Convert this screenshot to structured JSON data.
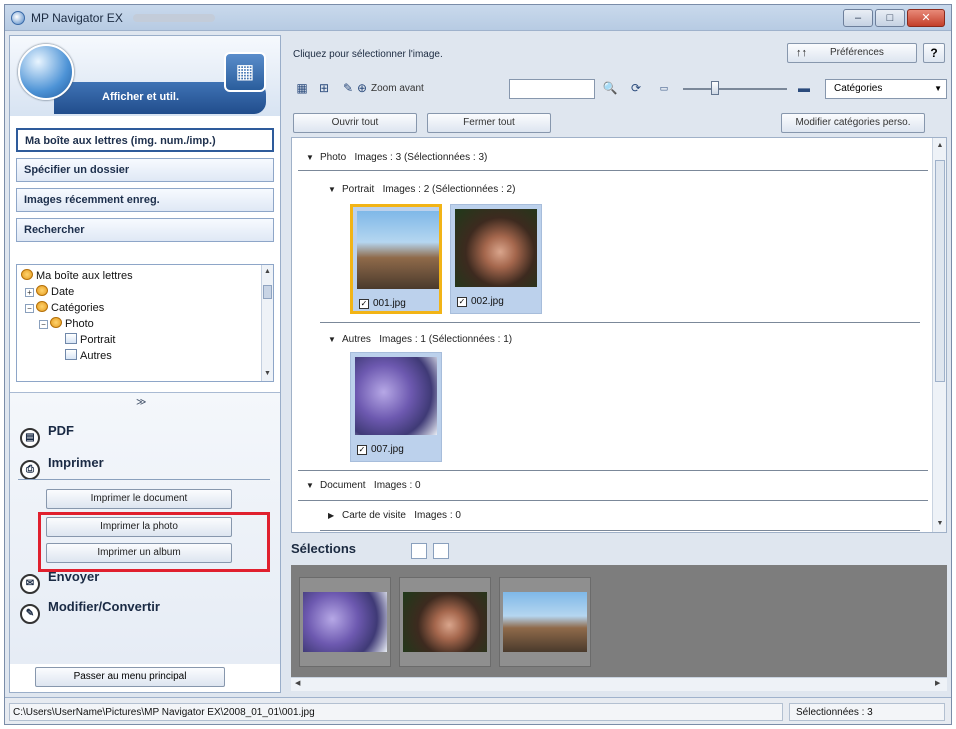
{
  "window": {
    "title": "MP Navigator EX",
    "buttons": {
      "minimize": "–",
      "maximize": "□",
      "close": "✕"
    }
  },
  "left": {
    "header_label": "Afficher et util.",
    "nav": [
      "Ma boîte aux lettres (img. num./imp.)",
      "Spécifier un dossier",
      "Images récemment enreg.",
      "Rechercher"
    ],
    "tree": [
      "Ma boîte aux lettres",
      "Date",
      "Catégories",
      "Photo",
      "Portrait",
      "Autres"
    ],
    "collapse_glyph": "≫",
    "actions": {
      "pdf": "PDF",
      "print": "Imprimer",
      "send": "Envoyer",
      "edit": "Modifier/Convertir"
    },
    "print_buttons": [
      "Imprimer le document",
      "Imprimer la photo",
      "Imprimer un album"
    ],
    "main_menu": "Passer au menu principal"
  },
  "toolbar": {
    "prompt": "Cliquez pour sélectionner l'image.",
    "preferences": "Préférences",
    "help": "?",
    "zoom_label": "Zoom avant",
    "category_select": "Catégories",
    "open_all": "Ouvrir tout",
    "close_all": "Fermer tout",
    "edit_categories": "Modifier catégories perso."
  },
  "groups": {
    "photo": {
      "name": "Photo",
      "info": "Images : 3   (Sélectionnées : 3)"
    },
    "portrait": {
      "name": "Portrait",
      "info": "Images : 2   (Sélectionnées : 2)"
    },
    "autres": {
      "name": "Autres",
      "info": "Images : 1   (Sélectionnées : 1)"
    },
    "document": {
      "name": "Document",
      "info": "Images : 0"
    },
    "carte": {
      "name": "Carte de visite",
      "info": "Images : 0"
    }
  },
  "files": [
    "001.jpg",
    "002.jpg",
    "007.jpg"
  ],
  "selections_label": "Sélections",
  "status": {
    "path": "C:\\Users\\UserName\\Pictures\\MP Navigator EX\\2008_01_01\\001.jpg",
    "selected": "Sélectionnées : 3"
  }
}
